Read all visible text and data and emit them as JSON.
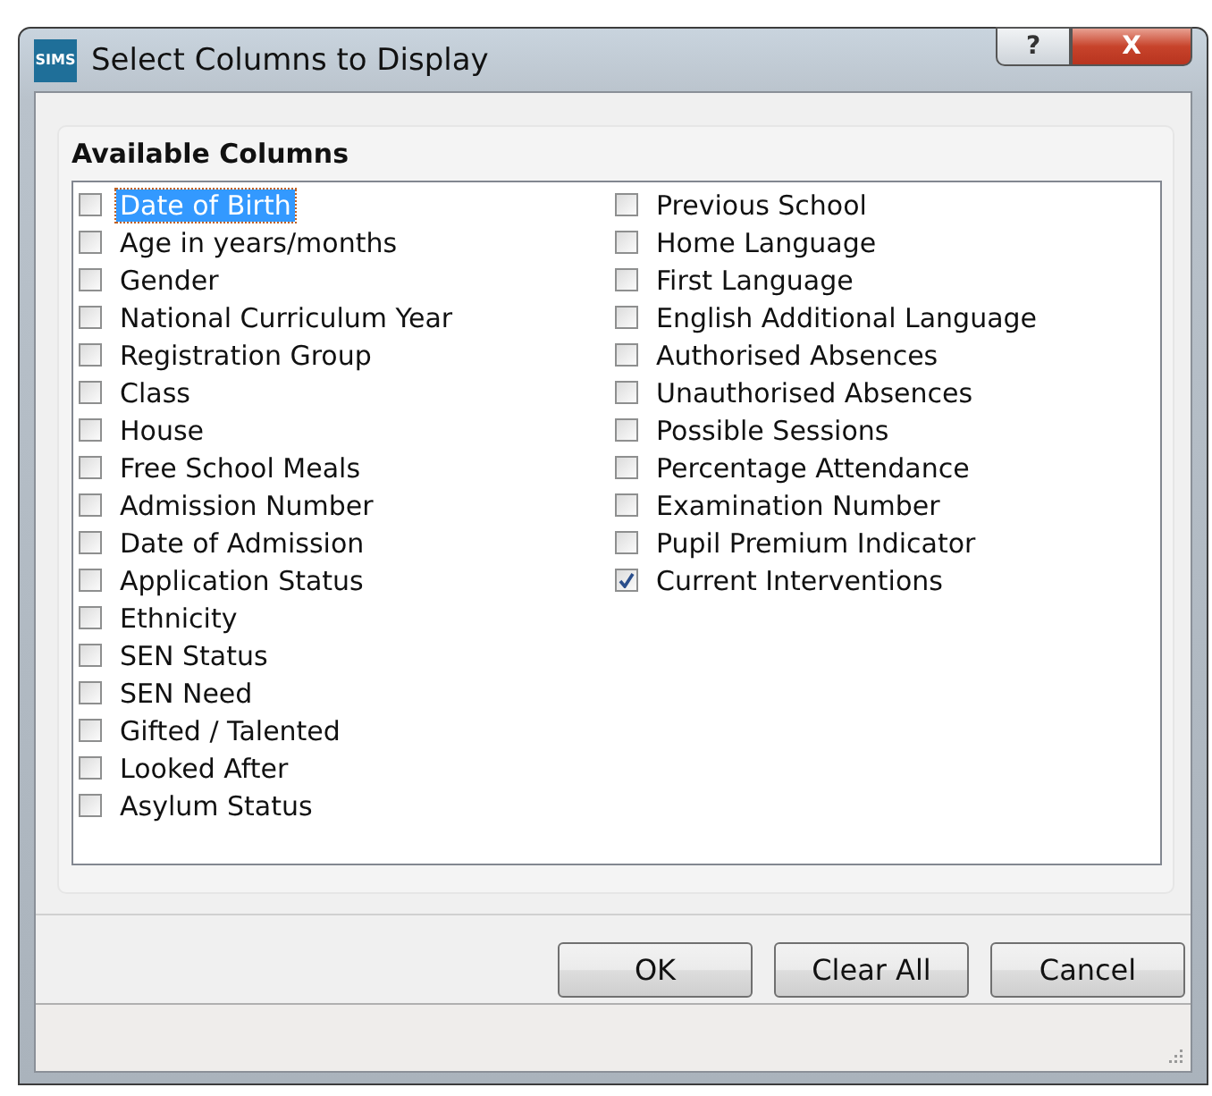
{
  "window": {
    "app_badge": "SIMS",
    "title": "Select Columns to Display",
    "help": "?",
    "close": "X"
  },
  "group": {
    "title": "Available Columns"
  },
  "columns": [
    [
      {
        "label": "Date of Birth",
        "checked": false,
        "selected": true
      },
      {
        "label": "Age in years/months",
        "checked": false,
        "selected": false
      },
      {
        "label": "Gender",
        "checked": false,
        "selected": false
      },
      {
        "label": "National Curriculum Year",
        "checked": false,
        "selected": false
      },
      {
        "label": "Registration Group",
        "checked": false,
        "selected": false
      },
      {
        "label": "Class",
        "checked": false,
        "selected": false
      },
      {
        "label": "House",
        "checked": false,
        "selected": false
      },
      {
        "label": "Free School Meals",
        "checked": false,
        "selected": false
      },
      {
        "label": "Admission Number",
        "checked": false,
        "selected": false
      },
      {
        "label": "Date of Admission",
        "checked": false,
        "selected": false
      },
      {
        "label": "Application Status",
        "checked": false,
        "selected": false
      },
      {
        "label": "Ethnicity",
        "checked": false,
        "selected": false
      },
      {
        "label": "SEN Status",
        "checked": false,
        "selected": false
      },
      {
        "label": "SEN Need",
        "checked": false,
        "selected": false
      },
      {
        "label": "Gifted / Talented",
        "checked": false,
        "selected": false
      },
      {
        "label": "Looked After",
        "checked": false,
        "selected": false
      },
      {
        "label": "Asylum Status",
        "checked": false,
        "selected": false
      }
    ],
    [
      {
        "label": "Previous School",
        "checked": false,
        "selected": false
      },
      {
        "label": "Home Language",
        "checked": false,
        "selected": false
      },
      {
        "label": "First Language",
        "checked": false,
        "selected": false
      },
      {
        "label": "English Additional Language",
        "checked": false,
        "selected": false
      },
      {
        "label": "Authorised Absences",
        "checked": false,
        "selected": false
      },
      {
        "label": "Unauthorised Absences",
        "checked": false,
        "selected": false
      },
      {
        "label": "Possible Sessions",
        "checked": false,
        "selected": false
      },
      {
        "label": "Percentage Attendance",
        "checked": false,
        "selected": false
      },
      {
        "label": "Examination Number",
        "checked": false,
        "selected": false
      },
      {
        "label": "Pupil Premium Indicator",
        "checked": false,
        "selected": false
      },
      {
        "label": "Current Interventions",
        "checked": true,
        "selected": false
      }
    ]
  ],
  "buttons": [
    "OK",
    "Clear All",
    "Cancel"
  ]
}
